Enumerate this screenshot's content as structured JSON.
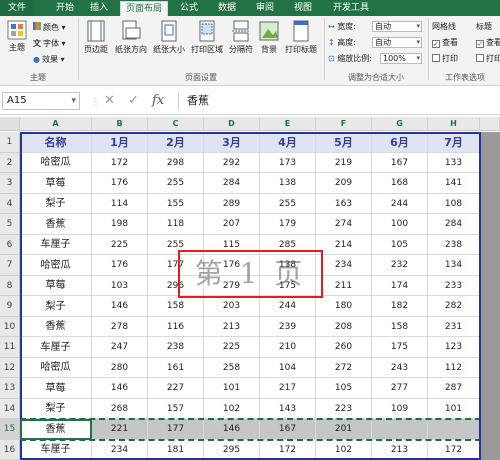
{
  "tabs": [
    "文件",
    "开始",
    "插入",
    "页面布局",
    "公式",
    "数据",
    "审阅",
    "视图",
    "开发工具"
  ],
  "active_tab": "页面布局",
  "ribbon": {
    "theme_group": {
      "theme_label": "主题",
      "colors_label": "颜色",
      "fonts_label": "字体",
      "effects_label": "效果",
      "group_label": "主题"
    },
    "page_setup": {
      "buttons": [
        "页边距",
        "纸张方向",
        "纸张大小",
        "打印区域",
        "分隔符",
        "背景",
        "打印标题"
      ],
      "group_label": "页面设置"
    },
    "scale": {
      "width_label": "宽度:",
      "width_value": "自动",
      "height_label": "高度:",
      "height_value": "自动",
      "scale_label": "缩放比例:",
      "scale_value": "100%",
      "group_label": "调整为合适大小"
    },
    "sheet_options": {
      "gridlines_label": "网格线",
      "headings_label": "标题",
      "view_label": "查看",
      "print_label": "打印",
      "group_label": "工作表选项"
    }
  },
  "formula_bar": {
    "name_box": "A15",
    "cancel_icon": "✕",
    "enter_icon": "✓",
    "fx_label": "fx",
    "formula": "香蕉"
  },
  "columns": [
    "A",
    "B",
    "C",
    "D",
    "E",
    "F",
    "G",
    "H"
  ],
  "rows": [
    "1",
    "2",
    "3",
    "4",
    "5",
    "6",
    "7",
    "8",
    "9",
    "10",
    "11",
    "12",
    "13",
    "14",
    "15",
    "16"
  ],
  "table": {
    "header": [
      "名称",
      "1月",
      "2月",
      "3月",
      "4月",
      "5月",
      "6月",
      "7月"
    ],
    "body": [
      [
        "哈密瓜",
        "172",
        "298",
        "292",
        "173",
        "219",
        "167",
        "133"
      ],
      [
        "草莓",
        "176",
        "255",
        "284",
        "138",
        "209",
        "168",
        "141"
      ],
      [
        "梨子",
        "114",
        "155",
        "289",
        "255",
        "163",
        "244",
        "108"
      ],
      [
        "香蕉",
        "198",
        "118",
        "207",
        "179",
        "274",
        "100",
        "284"
      ],
      [
        "车厘子",
        "225",
        "255",
        "115",
        "285",
        "214",
        "105",
        "238"
      ],
      [
        "哈密瓜",
        "176",
        "177",
        "176",
        "138",
        "234",
        "232",
        "134"
      ],
      [
        "草莓",
        "103",
        "296",
        "279",
        "175",
        "211",
        "174",
        "233"
      ],
      [
        "梨子",
        "146",
        "158",
        "203",
        "244",
        "180",
        "182",
        "282"
      ],
      [
        "香蕉",
        "278",
        "116",
        "213",
        "239",
        "208",
        "158",
        "231"
      ],
      [
        "车厘子",
        "247",
        "238",
        "225",
        "210",
        "260",
        "175",
        "123"
      ],
      [
        "哈密瓜",
        "280",
        "161",
        "258",
        "104",
        "272",
        "243",
        "112"
      ],
      [
        "草莓",
        "146",
        "227",
        "101",
        "217",
        "105",
        "277",
        "287"
      ],
      [
        "梨子",
        "268",
        "157",
        "102",
        "143",
        "223",
        "109",
        "101"
      ],
      [
        "香蕉",
        "221",
        "177",
        "146",
        "167",
        "201",
        "",
        ""
      ],
      [
        "车厘子",
        "234",
        "181",
        "295",
        "172",
        "102",
        "213",
        "172"
      ]
    ]
  },
  "watermark_text": "第 1 页",
  "colors": {
    "accent": "#217346",
    "header_text": "#3b3b9a",
    "page_border": "#2233aa",
    "watermark_box": "#e02020"
  }
}
